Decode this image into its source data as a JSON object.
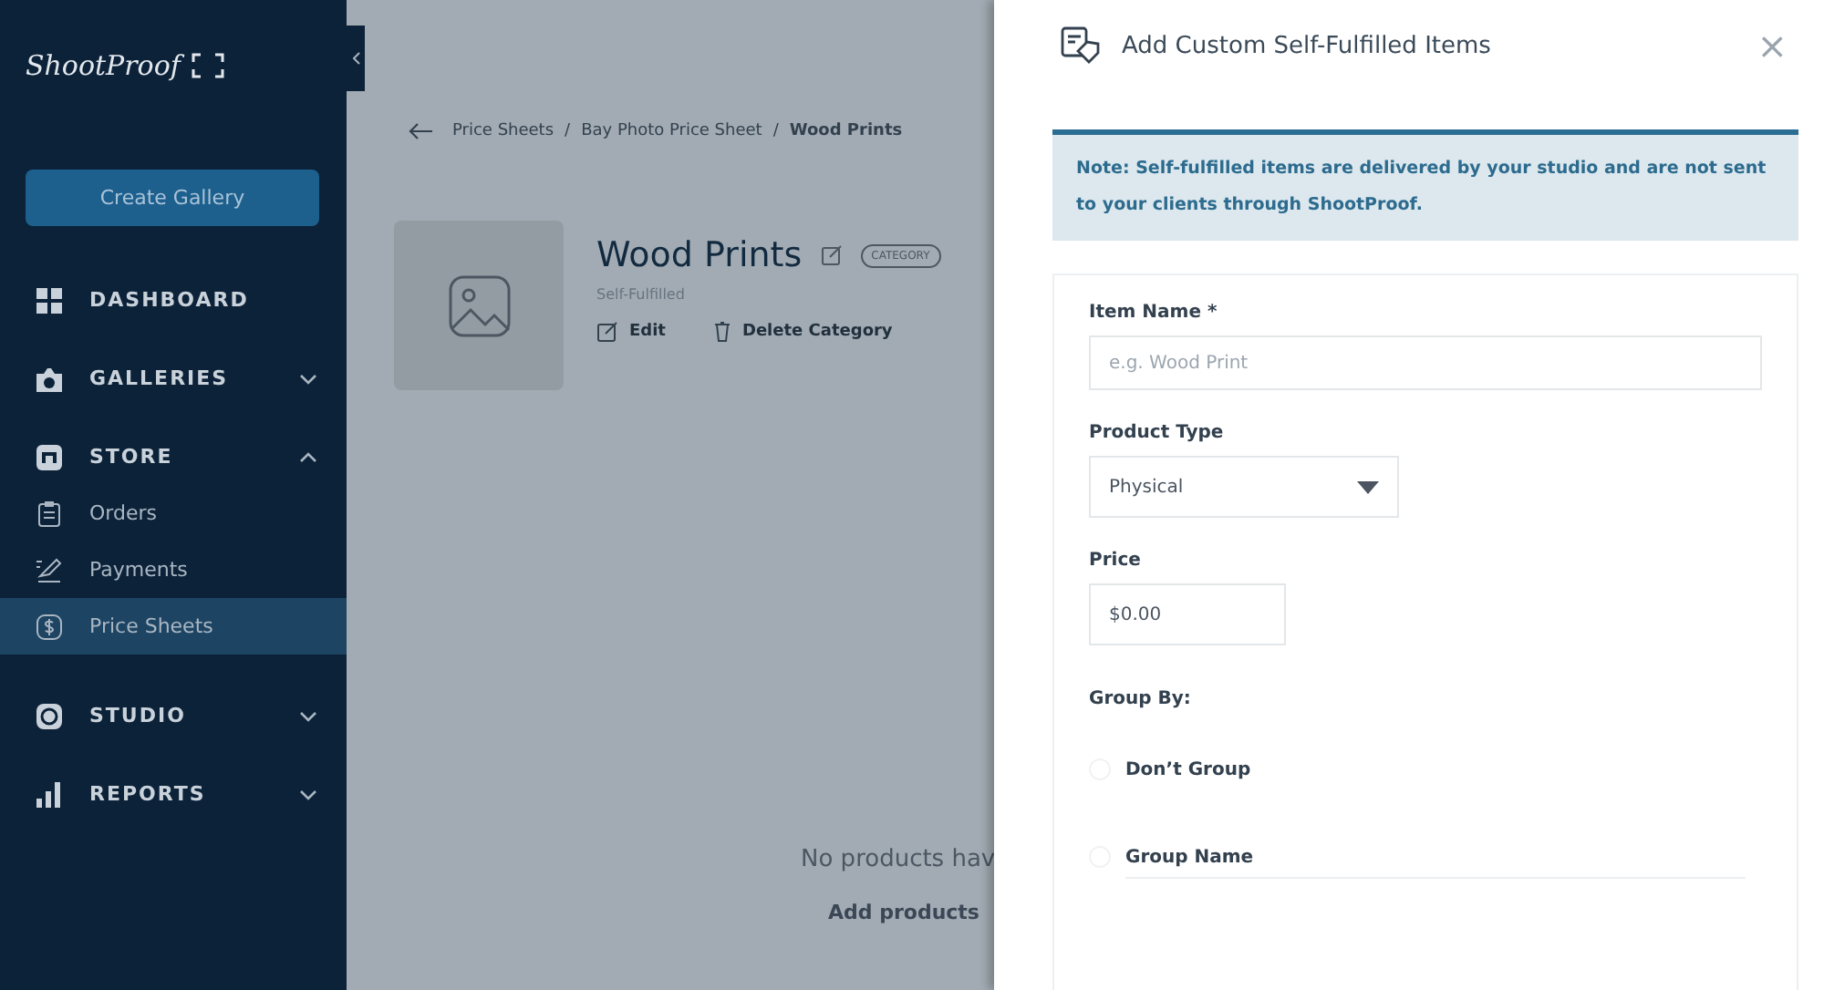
{
  "sidebar": {
    "logo": "ShootProof",
    "create_button": "Create Gallery",
    "items": [
      {
        "label": "DASHBOARD",
        "selected": false
      },
      {
        "label": "GALLERIES",
        "expanded": false,
        "selected": false
      },
      {
        "label": "STORE",
        "expanded": true,
        "selected": false,
        "children": [
          {
            "label": "Orders",
            "selected": false
          },
          {
            "label": "Payments",
            "selected": false
          },
          {
            "label": "Price Sheets",
            "selected": true
          }
        ]
      },
      {
        "label": "STUDIO",
        "expanded": false,
        "selected": false
      },
      {
        "label": "REPORTS",
        "expanded": false,
        "selected": false
      }
    ]
  },
  "breadcrumb": [
    {
      "kind": "link",
      "label": "Price Sheets"
    },
    {
      "kind": "separator",
      "label": "/"
    },
    {
      "kind": "link",
      "label": "Bay Photo Price Sheet"
    },
    {
      "kind": "separator",
      "label": "/"
    },
    {
      "kind": "current",
      "label": "Wood Prints"
    }
  ],
  "category": {
    "title": "Wood Prints",
    "badge": "CATEGORY",
    "subtitle": "Self-Fulfilled",
    "actions": [
      {
        "kind": "edit",
        "label": "Edit"
      },
      {
        "kind": "delete",
        "label": "Delete Category"
      }
    ]
  },
  "empty_state": {
    "message": "No products hav",
    "hint": "Add products"
  },
  "panel": {
    "title": "Add Custom Self-Fulfilled Items",
    "close": "×",
    "note": "Note: Self-fulfilled items are delivered by your studio and are not sent to your clients through ShootProof.",
    "fields": [
      {
        "kind": "text",
        "label": "Item Name *",
        "placeholder": "e.g. Wood Print"
      },
      {
        "kind": "select",
        "label": "Product Type",
        "value": "Physical"
      },
      {
        "kind": "money",
        "label": "Price",
        "value": "$0.00"
      }
    ],
    "group_by": {
      "label": "Group By:",
      "options": [
        {
          "label": "Don’t Group",
          "selected": false
        },
        {
          "label": "Group Name",
          "selected": false
        }
      ]
    }
  }
}
